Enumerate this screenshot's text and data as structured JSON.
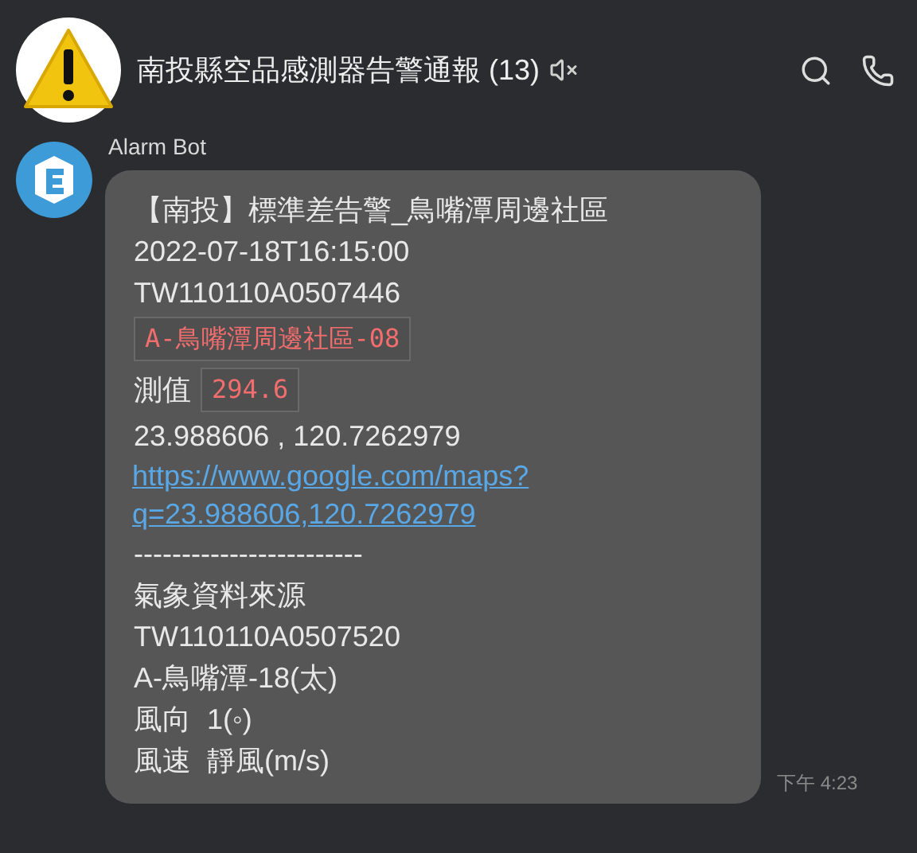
{
  "header": {
    "title": "南投縣空品感測器告警通報 (13)",
    "muted": true
  },
  "message": {
    "sender": "Alarm Bot",
    "time": "下午 4:23",
    "lines": [
      {
        "kind": "text",
        "text": "【南投】標準差告警_鳥嘴潭周邊社區"
      },
      {
        "kind": "text",
        "text": "2022-07-18T16:15:00"
      },
      {
        "kind": "text",
        "text": "TW110110A0507446"
      },
      {
        "kind": "code",
        "code": "A-鳥嘴潭周邊社區-08"
      },
      {
        "kind": "labeled_code",
        "label": "測值",
        "code": "294.6"
      },
      {
        "kind": "text",
        "text": "23.988606 , 120.7262979"
      },
      {
        "kind": "link",
        "parts": [
          "https://www.google.com/maps?",
          "q=23.988606,120.7262979"
        ]
      },
      {
        "kind": "text",
        "text": "------------------------"
      },
      {
        "kind": "text",
        "text": "氣象資料來源"
      },
      {
        "kind": "text",
        "text": "TW110110A0507520"
      },
      {
        "kind": "text",
        "text": "A-鳥嘴潭-18(太)"
      },
      {
        "kind": "text",
        "text": "風向  1(◦)"
      },
      {
        "kind": "text",
        "text": "風速  靜風(m/s)"
      }
    ]
  }
}
